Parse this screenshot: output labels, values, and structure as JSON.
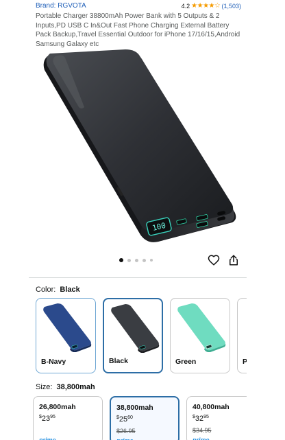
{
  "product": {
    "brand": "Brand: RGVOTA",
    "rating": "4.2",
    "stars": "★★★★☆",
    "rating_count": "(1,503)",
    "title": "Portable Charger 38800mAh Power Bank with 5 Outputs & 2 Inputs,PD USB C In&Out Fast Phone Charging External Battery Pack Backup,Travel Essential Outdoor for iPhone 17/16/15,Android Samsung Galaxy etc",
    "image": {
      "display_readout": "100"
    }
  },
  "gallery": {
    "image_count": 5,
    "active_index": 0
  },
  "color": {
    "label": "Color:",
    "selected": "Black",
    "options": [
      {
        "name": "B-Navy",
        "body": "#2b4a8c"
      },
      {
        "name": "Black",
        "body": "#3a3d42"
      },
      {
        "name": "Green",
        "body": "#6fdcc0"
      },
      {
        "name": "P"
      }
    ]
  },
  "size": {
    "label": "Size:",
    "selected": "38,800mah",
    "options": [
      {
        "name": "26,800mah",
        "currency": "$",
        "whole": "23",
        "fraction": "95",
        "list_price": "",
        "prime": "prime"
      },
      {
        "name": "38,800mah",
        "currency": "$",
        "whole": "25",
        "fraction": "60",
        "list_price": "$26.95",
        "prime": "prime"
      },
      {
        "name": "40,800mah",
        "currency": "$",
        "whole": "32",
        "fraction": "95",
        "list_price": "$34.95",
        "prime": "prime"
      }
    ]
  }
}
